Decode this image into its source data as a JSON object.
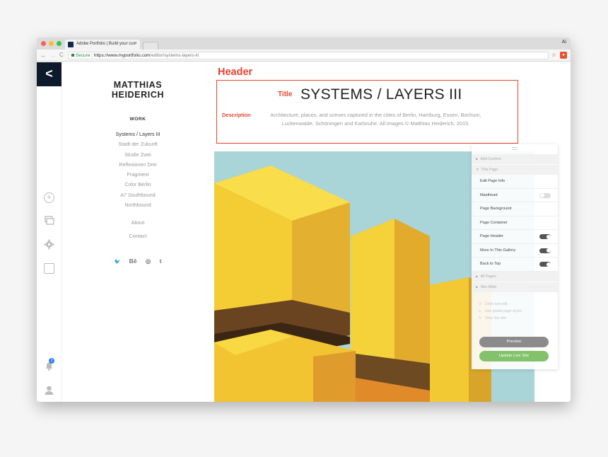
{
  "browser": {
    "tab_title": "Adobe Portfolio | Build your cus",
    "tab_close": "×",
    "profile_badge": "Ai",
    "secure_label": "Secure",
    "url_host": "https://www.myportfolio.com",
    "url_path": "/editor/systems-layers-iii",
    "back_glyph": "←",
    "forward_glyph": "→",
    "reload_glyph": "C",
    "star_glyph": "☆",
    "ext_glyph": "●"
  },
  "leftbar": {
    "back_glyph": "<",
    "notification_count": "2"
  },
  "portfolio": {
    "name_line1": "MATTHIAS",
    "name_line2": "HEIDERICH",
    "nav_heading": "WORK",
    "nav_items": [
      {
        "label": "Systems / Layers III",
        "active": true
      },
      {
        "label": "Stadt der Zukunft"
      },
      {
        "label": "Studie Zwei"
      },
      {
        "label": "Reflexionen Drei"
      },
      {
        "label": "Fragment"
      },
      {
        "label": "Color Berlin"
      },
      {
        "label": "A7 Southbound"
      },
      {
        "label": "Northbound"
      }
    ],
    "about": "About",
    "contact": "Contact",
    "social": [
      "twitter-icon",
      "behance-icon",
      "instagram-icon",
      "tumblr-icon"
    ],
    "social_glyphs": {
      "twitter": "🐦",
      "behance": "Bē",
      "instagram": "◎",
      "tumblr": "t"
    }
  },
  "main": {
    "header_annotation": "Header",
    "title_annotation": "Title",
    "page_title": "SYSTEMS / LAYERS III",
    "description_annotation": "Description",
    "description_text": "Architecture, places, and scenes captured in the cities of Berlin, Hamburg, Essen, Bochum, Luckenwalde, Schöningen and Karlsruhe. All images © Matthias Heiderich, 2015."
  },
  "panel": {
    "add_content": "Add Content",
    "this_page": "This Page",
    "rows": [
      {
        "label": "Edit Page Info"
      },
      {
        "label": "Masthead",
        "toggle": "off"
      },
      {
        "label": "Page Background"
      },
      {
        "label": "Page Container"
      },
      {
        "label": "Page Header",
        "toggle": "on"
      },
      {
        "label": "More In This Gallery",
        "toggle": "on"
      },
      {
        "label": "Back to Top",
        "toggle": "on"
      }
    ],
    "all_pages": "All Pages",
    "site_wide": "Site-Wide",
    "links": [
      "Undo last edit",
      "Use global page styles",
      "View live site"
    ],
    "preview_label": "Preview",
    "update_label": "Update Live Site"
  },
  "colors": {
    "annotation": "#e8432e",
    "dark_nav": "#0d1a2b",
    "update_button": "#82c26a",
    "preview_button": "#8b8b8b",
    "sky": "#a8d4d8",
    "cube_yellow": "#f3cf31"
  }
}
